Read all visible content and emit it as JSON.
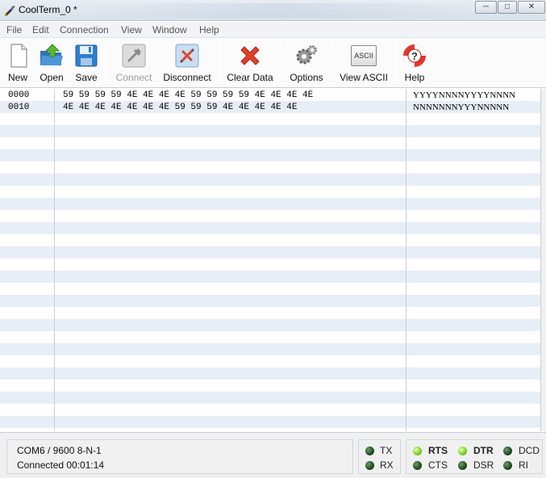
{
  "window": {
    "title": "CoolTerm_0 *",
    "buttons": {
      "minimize": "─",
      "maximize": "□",
      "close": "✕"
    }
  },
  "menu": [
    "File",
    "Edit",
    "Connection",
    "View",
    "Window",
    "Help"
  ],
  "toolbar": {
    "new": "New",
    "open": "Open",
    "save": "Save",
    "connect": "Connect",
    "disconnect": "Disconnect",
    "clear_data": "Clear Data",
    "options": "Options",
    "view_ascii": "View ASCII",
    "help": "Help",
    "ascii_icon_text": "ASCII",
    "connect_enabled": false
  },
  "data": {
    "rows": [
      {
        "address": "0000",
        "hex": "59 59 59 59 4E 4E 4E 4E 59 59 59 59 4E 4E 4E 4E",
        "ascii": "YYYYNNNNYYYYNNNN"
      },
      {
        "address": "0010",
        "hex": "4E 4E 4E 4E 4E 4E 4E 59 59 59 4E 4E 4E 4E 4E",
        "ascii": "NNNNNNNYYYNNNNN"
      }
    ]
  },
  "status": {
    "port_settings": "COM6 / 9600 8-N-1",
    "connection": "Connected 00:01:14",
    "lamps": {
      "tx": {
        "label": "TX",
        "on": false
      },
      "rx": {
        "label": "RX",
        "on": false
      },
      "rts": {
        "label": "RTS",
        "on": true
      },
      "cts": {
        "label": "CTS",
        "on": false
      },
      "dtr": {
        "label": "DTR",
        "on": true
      },
      "dsr": {
        "label": "DSR",
        "on": false
      },
      "dcd": {
        "label": "DCD",
        "on": false
      },
      "ri": {
        "label": "RI",
        "on": false
      }
    }
  },
  "colors": {
    "row_stripe": "#e8eef6",
    "lamp_on": "#7fd52a",
    "lamp_off": "#1f4a1f",
    "disabled_text": "#9a9a9a"
  }
}
